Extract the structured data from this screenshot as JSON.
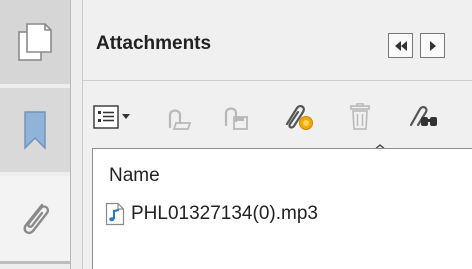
{
  "sidebar": {
    "tabs": [
      {
        "icon": "pages-icon"
      },
      {
        "icon": "bookmark-icon"
      },
      {
        "icon": "paperclip-icon",
        "active": true
      }
    ]
  },
  "panel": {
    "title": "Attachments",
    "nav": {
      "prev_icon": "rewind-icon",
      "next_icon": "play-icon"
    }
  },
  "toolbar": {
    "items": [
      {
        "icon": "options-menu-icon",
        "enabled": true
      },
      {
        "icon": "open-attachment-icon",
        "enabled": false
      },
      {
        "icon": "save-attachment-icon",
        "enabled": false
      },
      {
        "icon": "add-attachment-icon",
        "enabled": true
      },
      {
        "icon": "trash-icon",
        "enabled": false
      },
      {
        "icon": "search-attachments-icon",
        "enabled": true
      }
    ]
  },
  "list": {
    "column_header": "Name",
    "rows": [
      {
        "name": "PHL01327134(0).mp3",
        "icon": "audio-file-icon"
      }
    ]
  },
  "colors": {
    "accent_blue": "#2b79d6",
    "disabled_gray": "#b8b8b8",
    "highlight_orange": "#f2a900"
  }
}
